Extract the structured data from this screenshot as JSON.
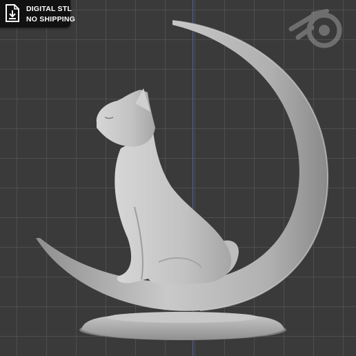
{
  "badge": {
    "line1": "DIGITAL STL",
    "line2": "NO SHIPPING"
  },
  "icons": {
    "badge_icon": "download-file-icon",
    "watermark": "blender-logo-icon"
  },
  "colors": {
    "viewport_bg": "#3a3a3a",
    "grid_line": "#505050",
    "axis_y": "#5b6fa8",
    "model": "#bcbcbc",
    "badge_bg": "#111111",
    "badge_text": "#ffffff"
  }
}
